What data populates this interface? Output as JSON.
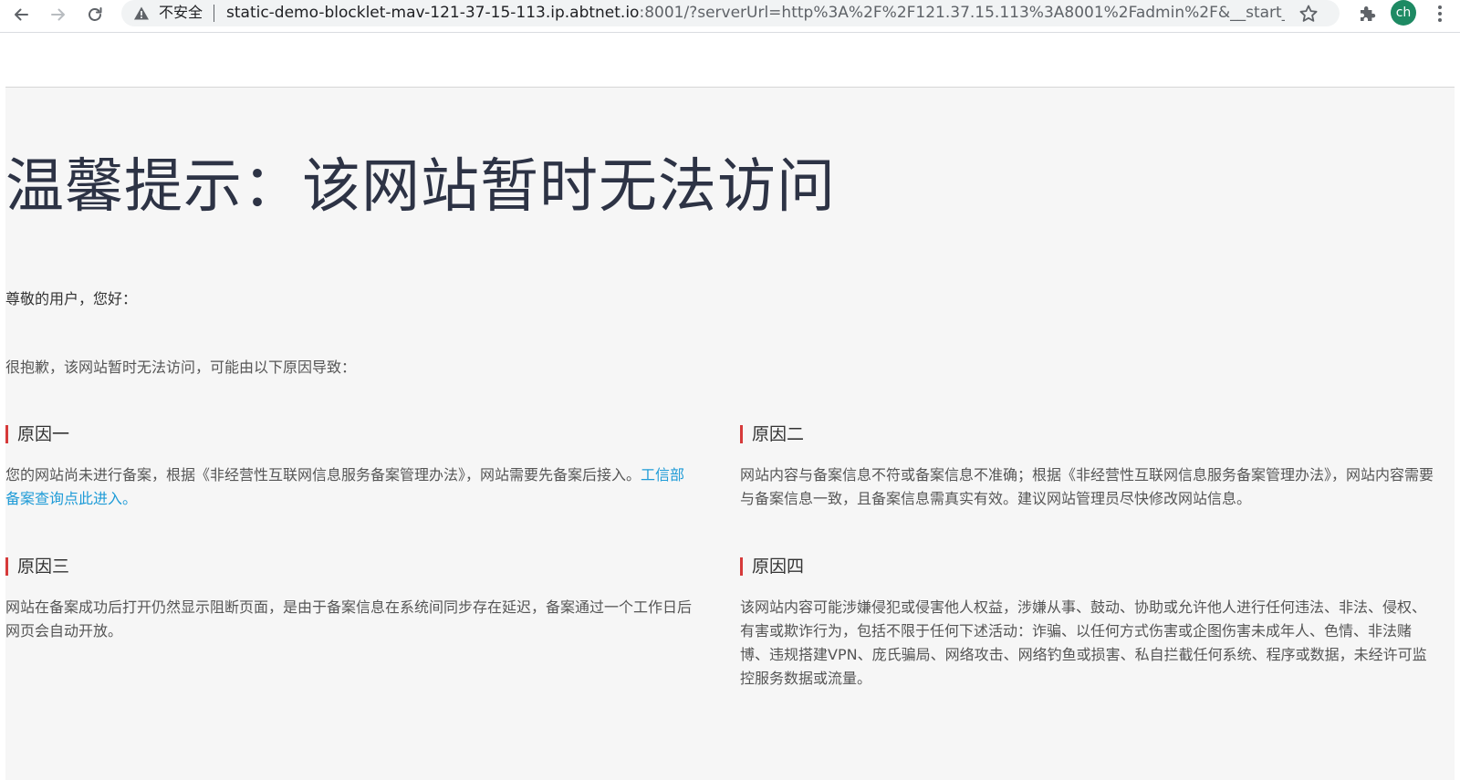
{
  "browser": {
    "security_label": "不安全",
    "url_host": "static-demo-blocklet-mav-121-37-15-113.ip.abtnet.io",
    "url_rest": ":8001/?serverUrl=http%3A%2F%2F121.37.15.113%3A8001%2Fadmin%2F&__start__...",
    "profile_initials": "ch",
    "profile_color": "#1e8a63"
  },
  "notice": {
    "title": "温馨提示：该网站暂时无法访问",
    "greeting": "尊敬的用户，您好：",
    "intro": "很抱歉，该网站暂时无法访问，可能由以下原因导致：",
    "accent_color": "#d63a3a",
    "link_color": "#1e9bd7",
    "reasons": [
      {
        "title": "原因一",
        "text": "您的网站尚未进行备案，根据《非经营性互联网信息服务备案管理办法》，网站需要先备案后接入。",
        "link": "工信部备案查询点此进入。"
      },
      {
        "title": "原因二",
        "text": "网站内容与备案信息不符或备案信息不准确；根据《非经营性互联网信息服务备案管理办法》，网站内容需要与备案信息一致，且备案信息需真实有效。建议网站管理员尽快修改网站信息。"
      },
      {
        "title": "原因三",
        "text": "网站在备案成功后打开仍然显示阻断页面，是由于备案信息在系统间同步存在延迟，备案通过一个工作日后网页会自动开放。"
      },
      {
        "title": "原因四",
        "text": "该网站内容可能涉嫌侵犯或侵害他人权益，涉嫌从事、鼓动、协助或允许他人进行任何违法、非法、侵权、有害或欺诈行为，包括不限于任何下述活动：诈骗、以任何方式伤害或企图伤害未成年人、色情、非法赌博、违规搭建VPN、庞氏骗局、网络攻击、网络钓鱼或损害、私自拦截任何系统、程序或数据，未经许可监控服务数据或流量。"
      }
    ]
  }
}
